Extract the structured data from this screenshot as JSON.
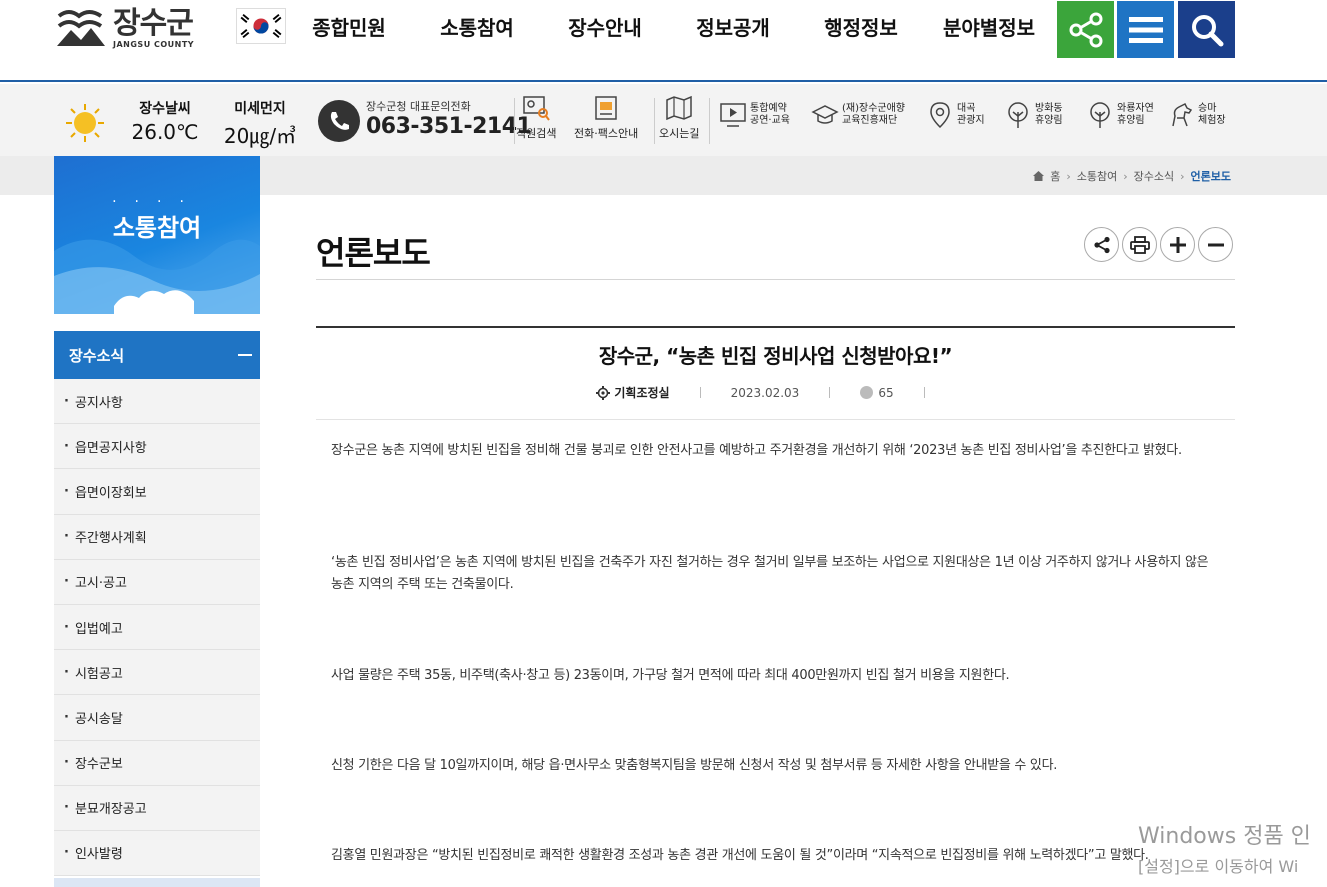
{
  "header": {
    "logo_text": "장수군",
    "logo_sub": "JANGSU COUNTY",
    "nav": [
      "종합민원",
      "소통참여",
      "장수안내",
      "정보공개",
      "행정정보",
      "분야별정보"
    ],
    "colors": {
      "share": "#3ba53b",
      "menu": "#1f74c4",
      "search": "#1b3f8b"
    }
  },
  "util": {
    "weather_label": "장수날씨",
    "weather_value": "26.0℃",
    "dust_label": "미세먼지",
    "dust_value": "20㎍/㎥",
    "phone_label": "장수군청 대표문의전화",
    "phone_number": "063-351-2141",
    "links": [
      "직원검색",
      "전화·팩스안내",
      "오시는길"
    ],
    "links2": [
      {
        "line1": "통합예약",
        "line2": "공연·교육"
      },
      {
        "line1": "(재)장수군애향",
        "line2": "교육진흥재단"
      },
      {
        "line1": "대곡",
        "line2": "관광지"
      },
      {
        "line1": "방화동",
        "line2": "휴양림"
      },
      {
        "line1": "와룡자연",
        "line2": "휴양림"
      },
      {
        "line1": "승마",
        "line2": "체험장"
      }
    ]
  },
  "breadcrumb": [
    "홈",
    "소통참여",
    "장수소식",
    "언론보도"
  ],
  "sidebar": {
    "banner_title": "소통참여",
    "section_title": "장수소식",
    "items": [
      "공지사항",
      "읍면공지사항",
      "읍면이장회보",
      "주간행사계획",
      "고시·공고",
      "입법예고",
      "시험공고",
      "공시송달",
      "장수군보",
      "분묘개장공고",
      "인사발령"
    ]
  },
  "main": {
    "page_title": "언론보도",
    "article": {
      "title": "장수군, “농촌 빈집 정비사업 신청받아요!”",
      "department": "기획조정실",
      "date": "2023.02.03",
      "views": "65",
      "paragraphs": [
        "장수군은 농촌 지역에 방치된 빈집을 정비해 건물 붕괴로 인한 안전사고를 예방하고 주거환경을 개선하기 위해 ‘2023년 농촌 빈집 정비사업’을 추진한다고 밝혔다.",
        "‘농촌 빈집 정비사업’은 농촌 지역에 방치된 빈집을 건축주가 자진 철거하는 경우 철거비 일부를 보조하는 사업으로 지원대상은 1년 이상 거주하지 않거나 사용하지 않은 농촌 지역의 주택 또는 건축물이다.",
        "사업 물량은 주택 35동, 비주택(축사·창고 등) 23동이며, 가구당 철거 면적에 따라 최대 400만원까지 빈집 철거 비용을 지원한다.",
        "신청 기한은 다음 달 10일까지이며, 해당 읍·면사무소 맞춤형복지팀을 방문해 신청서 작성 및 첨부서류 등 자세한 사항을 안내받을 수 있다.",
        "김홍열 민원과장은 “방치된 빈집정비로 쾌적한 생활환경 조성과 농촌 경관 개선에 도움이 될 것”이라며 “지속적으로 빈집정비를 위해 노력하겠다”고 말했다."
      ]
    }
  },
  "watermark": {
    "line1": "Windows 정품 인",
    "line2": "[설정]으로 이동하여 Wi"
  }
}
